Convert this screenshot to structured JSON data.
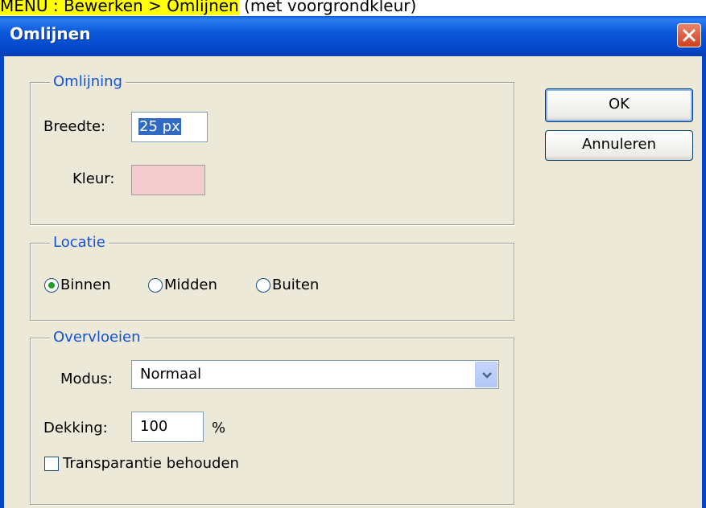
{
  "caption": {
    "menu": "MENU : Bewerken > Omlijnen",
    "note": " (met voorgrondkleur)"
  },
  "dialog": {
    "title": "Omlijnen",
    "ok_label": "OK",
    "cancel_label": "Annuleren"
  },
  "omlijning": {
    "legend": "Omlijning",
    "width_label": "Breedte:",
    "width_value": "25 px",
    "color_label": "Kleur:",
    "color_value": "#f4cbcf"
  },
  "locatie": {
    "legend": "Locatie",
    "options": [
      "Binnen",
      "Midden",
      "Buiten"
    ],
    "selected": "Binnen"
  },
  "overvloeien": {
    "legend": "Overvloeien",
    "mode_label": "Modus:",
    "mode_value": "Normaal",
    "opacity_label": "Dekking:",
    "opacity_value": "100",
    "opacity_unit": "%",
    "preserve_label": "Transparantie behouden",
    "preserve_checked": false
  },
  "icons": {
    "close": "close-icon",
    "dropdown": "chevron-down-icon",
    "radio": "radio-icon",
    "checkbox": "checkbox-icon"
  },
  "colors": {
    "titlebar": "#0346c8",
    "dialog_bg": "#ece9d8",
    "legend_text": "#1252d8",
    "highlight": "#ffff00",
    "selection": "#316ac5"
  }
}
